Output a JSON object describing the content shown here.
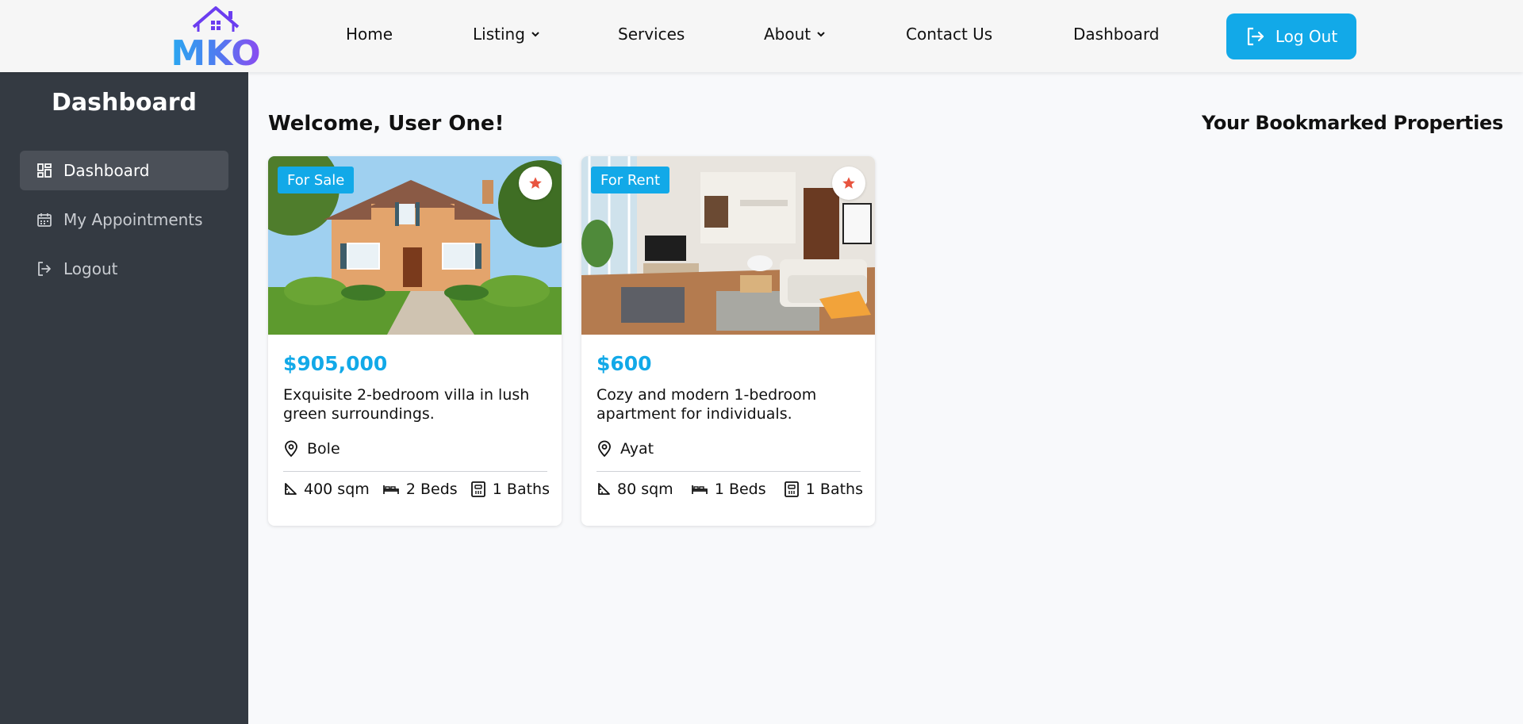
{
  "brand": {
    "logo_text": "MKO",
    "gradient_start": "#6b3df0",
    "gradient_end": "#2aa8f0"
  },
  "nav": {
    "home": "Home",
    "listing": "Listing",
    "services": "Services",
    "about": "About",
    "contact": "Contact Us",
    "dashboard": "Dashboard",
    "logout": "Log Out"
  },
  "sidebar": {
    "title": "Dashboard",
    "items": [
      {
        "label": "Dashboard",
        "icon": "grid-icon",
        "active": true
      },
      {
        "label": "My Appointments",
        "icon": "calendar-icon",
        "active": false
      },
      {
        "label": "Logout",
        "icon": "logout-icon",
        "active": false
      }
    ]
  },
  "main": {
    "welcome": "Welcome, User One!",
    "bookmarks_title": "Your Bookmarked Properties"
  },
  "cards": [
    {
      "badge": "For Sale",
      "price": "$905,000",
      "title": "Exquisite 2-bedroom villa in lush green surroundings.",
      "location": "Bole",
      "area": "400 sqm",
      "beds": "2 Beds",
      "baths": "1 Baths",
      "photo": "house-exterior-photo"
    },
    {
      "badge": "For Rent",
      "price": "$600",
      "title": "Cozy and modern 1-bedroom apartment for individuals.",
      "location": "Ayat",
      "area": "80 sqm",
      "beds": "1 Beds",
      "baths": "1 Baths",
      "photo": "apartment-interior-photo"
    }
  ],
  "colors": {
    "accent": "#12a9e8",
    "sidebar_bg": "#343a42",
    "star": "#e8543f"
  }
}
